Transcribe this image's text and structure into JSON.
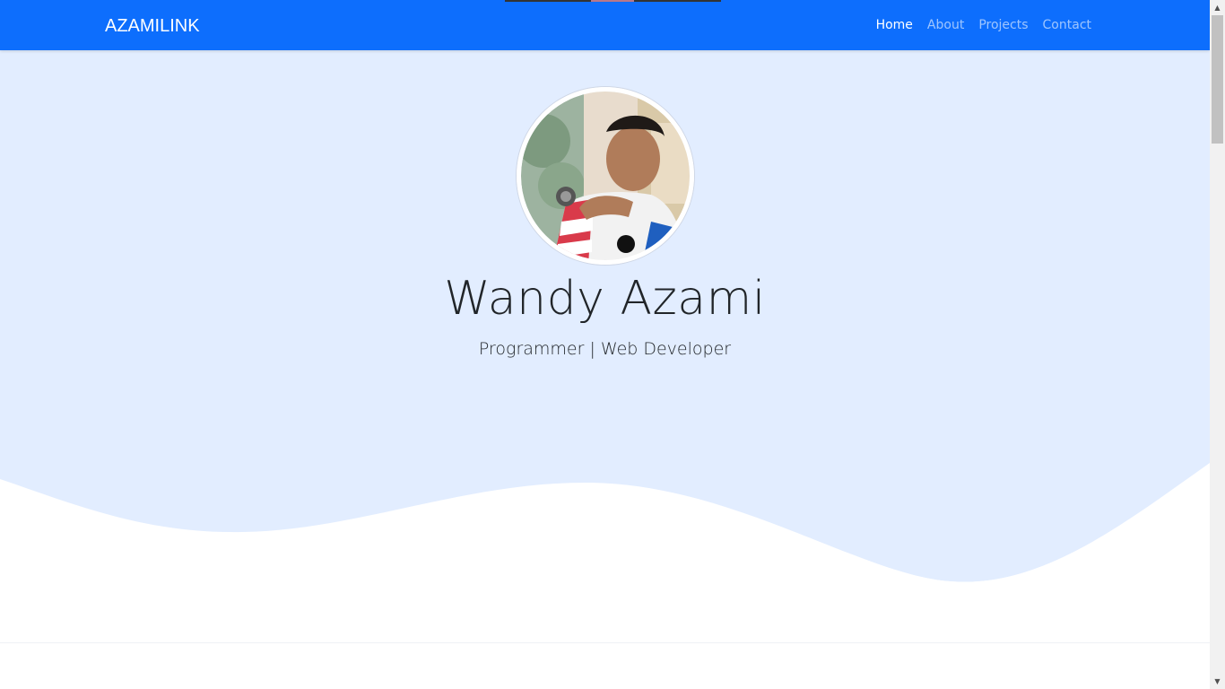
{
  "navbar": {
    "brand": "AZAMILINK",
    "links": [
      {
        "label": "Home",
        "active": true
      },
      {
        "label": "About",
        "active": false
      },
      {
        "label": "Projects",
        "active": false
      },
      {
        "label": "Contact",
        "active": false
      }
    ]
  },
  "hero": {
    "name": "Wandy Azami",
    "subtitle": "Programmer | Web Developer",
    "avatar_icon": "profile-photo"
  },
  "colors": {
    "navbar_bg": "#0d6efd",
    "hero_bg": "#e2edff",
    "text_dark": "#212529"
  }
}
